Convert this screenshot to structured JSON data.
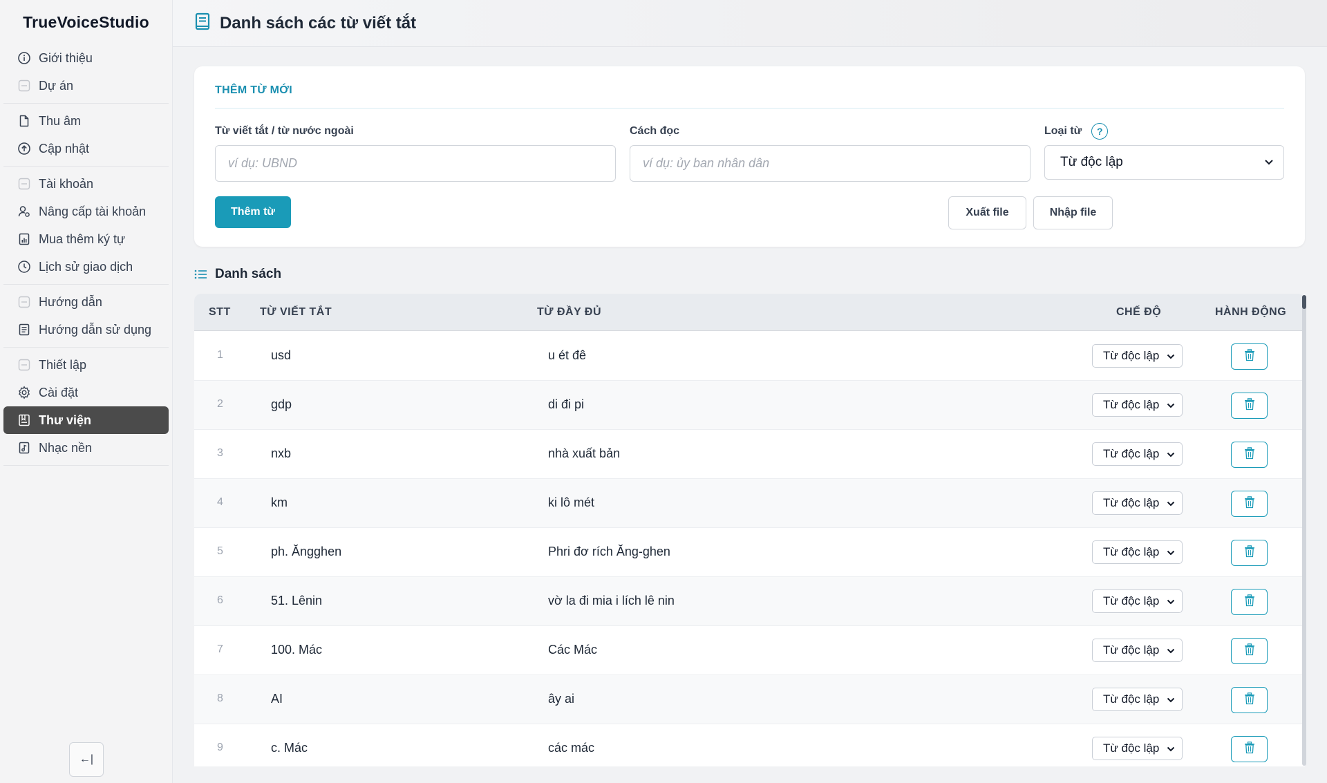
{
  "app": {
    "title": "TrueVoiceStudio"
  },
  "sidebar": {
    "items": [
      {
        "label": "Giới thiệu",
        "icon": "info-icon"
      },
      {
        "label": "Dự án",
        "icon": "collapsed-group-icon"
      },
      {
        "label": "Thu âm",
        "icon": "file-icon"
      },
      {
        "label": "Cập nhật",
        "icon": "upload-circle-icon"
      },
      {
        "label": "Tài khoản",
        "icon": "collapsed-group-icon"
      },
      {
        "label": "Nâng cấp tài khoản",
        "icon": "user-upgrade-icon"
      },
      {
        "label": "Mua thêm ký tự",
        "icon": "chart-file-icon"
      },
      {
        "label": "Lịch sử giao dịch",
        "icon": "history-icon"
      },
      {
        "label": "Hướng dẫn",
        "icon": "collapsed-group-icon"
      },
      {
        "label": "Hướng dẫn sử dụng",
        "icon": "guide-doc-icon"
      },
      {
        "label": "Thiết lập",
        "icon": "collapsed-group-icon"
      },
      {
        "label": "Cài đặt",
        "icon": "gear-icon"
      },
      {
        "label": "Thư viện",
        "icon": "library-icon",
        "active": true
      },
      {
        "label": "Nhạc nền",
        "icon": "music-file-icon"
      }
    ],
    "collapse_label": "←|"
  },
  "header": {
    "title": "Danh sách các từ viết tắt"
  },
  "add_form": {
    "title": "THÊM TỪ MỚI",
    "abbr_label": "Từ viết tắt / từ nước ngoài",
    "abbr_placeholder": "ví dụ: UBND",
    "reading_label": "Cách đọc",
    "reading_placeholder": "ví dụ: ủy ban nhân dân",
    "type_label": "Loại từ",
    "type_help": "?",
    "type_value": "Từ độc lập",
    "add_button": "Thêm từ",
    "export_button": "Xuất file",
    "import_button": "Nhập file"
  },
  "list": {
    "title": "Danh sách",
    "columns": {
      "stt": "STT",
      "abbr": "TỪ VIẾT TẮT",
      "full": "TỪ ĐẦY ĐỦ",
      "mode": "CHẾ ĐỘ",
      "action": "HÀNH ĐỘNG"
    },
    "rows": [
      {
        "stt": "1",
        "abbr": "usd",
        "full": "u ét đê",
        "mode": "Từ độc lập"
      },
      {
        "stt": "2",
        "abbr": "gdp",
        "full": "di đi pi",
        "mode": "Từ độc lập"
      },
      {
        "stt": "3",
        "abbr": "nxb",
        "full": "nhà xuất bản",
        "mode": "Từ độc lập"
      },
      {
        "stt": "4",
        "abbr": "km",
        "full": "ki lô mét",
        "mode": "Từ độc lập"
      },
      {
        "stt": "5",
        "abbr": "ph. Ăngghen",
        "full": "Phri đơ rích Ăng-ghen",
        "mode": "Từ độc lập"
      },
      {
        "stt": "6",
        "abbr": "51. Lênin",
        "full": "vờ la đi mia i lích lê nin",
        "mode": "Từ độc lập"
      },
      {
        "stt": "7",
        "abbr": "100. Mác",
        "full": "Các Mác",
        "mode": "Từ độc lập"
      },
      {
        "stt": "8",
        "abbr": "AI",
        "full": "ây ai",
        "mode": "Từ độc lập"
      },
      {
        "stt": "9",
        "abbr": "c. Mác",
        "full": "các mác",
        "mode": "Từ độc lập"
      }
    ]
  },
  "colors": {
    "accent": "#1a9bb8",
    "active_nav": "#4b4b4b",
    "title_accent": "#1a8fb0"
  }
}
